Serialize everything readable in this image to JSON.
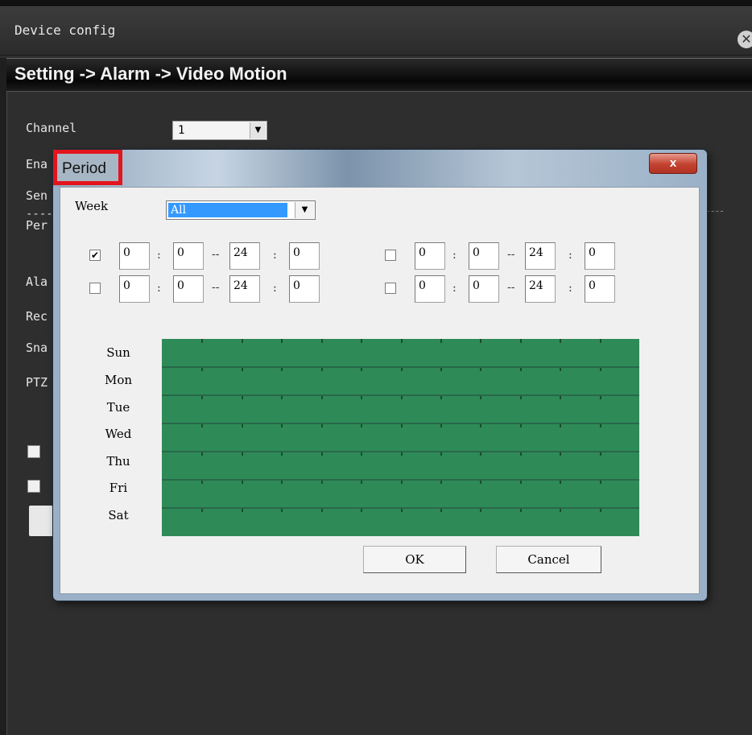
{
  "window": {
    "title": "Device config",
    "close_glyph": "✕"
  },
  "breadcrumb": "Setting -> Alarm -> Video Motion",
  "background_form": {
    "labels": [
      "Channel",
      "Ena",
      "Sen",
      "Per",
      "Ala",
      "Rec",
      "Sna",
      "PTZ"
    ],
    "dashes": "----",
    "channel_value": "1",
    "select_arrow": "▼"
  },
  "dialog": {
    "title": "Period",
    "close_glyph": "x",
    "week_label": "Week",
    "week_value": "All",
    "select_arrow": "▼",
    "periods": [
      {
        "checked": true,
        "start_h": "0",
        "start_m": "0",
        "end_h": "24",
        "end_m": "0"
      },
      {
        "checked": false,
        "start_h": "0",
        "start_m": "0",
        "end_h": "24",
        "end_m": "0"
      },
      {
        "checked": false,
        "start_h": "0",
        "start_m": "0",
        "end_h": "24",
        "end_m": "0"
      },
      {
        "checked": false,
        "start_h": "0",
        "start_m": "0",
        "end_h": "24",
        "end_m": "0"
      }
    ],
    "colon": ":",
    "dash": "--",
    "check_mark": "✔",
    "days": [
      "Sun",
      "Mon",
      "Tue",
      "Wed",
      "Thu",
      "Fri",
      "Sat"
    ],
    "grid_color": "#2e8b57",
    "ok_label": "OK",
    "cancel_label": "Cancel"
  }
}
